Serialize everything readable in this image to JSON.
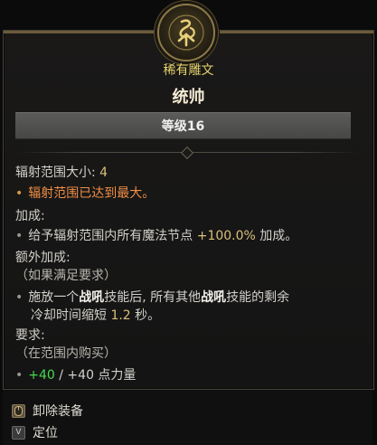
{
  "item": {
    "subtitle": "稀有雕文",
    "title": "统帅",
    "level_label": "等级16"
  },
  "stats": {
    "radius_label": "辐射范围大小: ",
    "radius_value": "4",
    "radius_max_note": "辐射范围已达到最大。",
    "bonus_header": "加成:",
    "bonus_text_pre": "给予辐射范围内所有魔法节点 ",
    "bonus_value": "+100.0%",
    "bonus_text_post": " 加成。",
    "extra_header": "额外加成:",
    "extra_condition": "（如果满足要求）",
    "extra_line1_a": "施放一个",
    "extra_line1_b": "战吼",
    "extra_line1_c": "技能后, 所有其他",
    "extra_line1_d": "战吼",
    "extra_line1_e": "技能的剩余",
    "extra_line2_a": "冷却时间缩短 ",
    "extra_line2_b": "1.2",
    "extra_line2_c": " 秒。",
    "req_header": "要求:",
    "req_condition": "（在范围内购买）",
    "req_current": "+40",
    "req_rest": " / +40 点力量"
  },
  "footer": {
    "unequip_label": "卸除装备",
    "locate_key": "V",
    "locate_label": "定位"
  },
  "colors": {
    "rare_gold": "#e6d36a",
    "orange": "#f08e46",
    "green": "#47d94d"
  }
}
